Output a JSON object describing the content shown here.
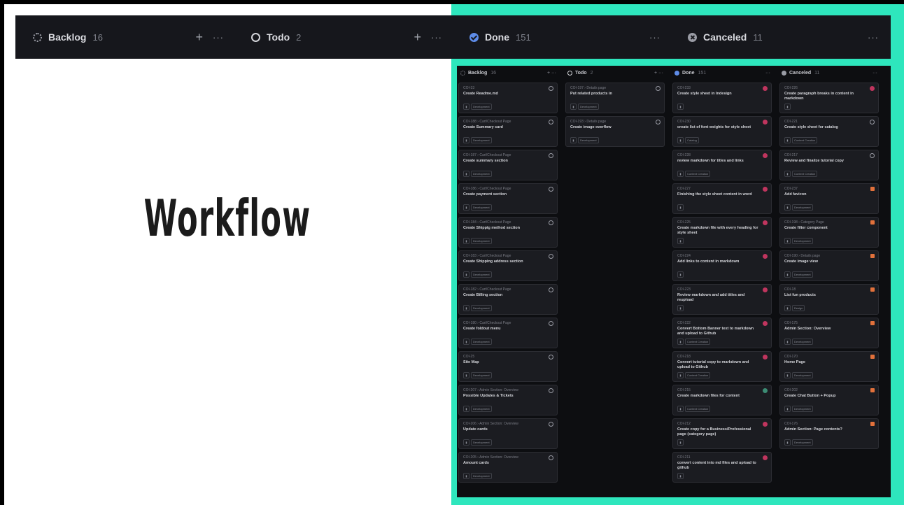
{
  "title": "Workflow",
  "header": {
    "columns": [
      {
        "icon": "backlog-status-icon",
        "name": "Backlog",
        "count": "16",
        "plus": "+",
        "more": "···"
      },
      {
        "icon": "todo-status-icon",
        "name": "Todo",
        "count": "2",
        "plus": "+",
        "more": "···"
      },
      {
        "icon": "done-status-icon",
        "name": "Done",
        "count": "151",
        "more": "···"
      },
      {
        "icon": "canceled-status-icon",
        "name": "Canceled",
        "count": "11",
        "more": "···"
      }
    ]
  },
  "board": {
    "columns": [
      {
        "name": "Backlog",
        "count": "16",
        "actions": "+ ···",
        "cards": [
          {
            "id": "COI-33",
            "title": "Create Readme.md",
            "tag": "Development"
          },
          {
            "id": "COI-188 › Cart/Checkout Page",
            "title": "Create Summary card",
            "tag": "Development"
          },
          {
            "id": "COI-187 › Cart/Checkout Page",
            "title": "Create summary section",
            "tag": "Development"
          },
          {
            "id": "COI-186 › Cart/Checkout Page",
            "title": "Create payment section",
            "tag": "Development"
          },
          {
            "id": "COI-184 › Cart/Checkout Page",
            "title": "Create Shippig method section",
            "tag": "Development"
          },
          {
            "id": "COI-183 › Cart/Checkout Page",
            "title": "Create Shipping address section",
            "tag": "Development"
          },
          {
            "id": "COI-182 › Cart/Checkout Page",
            "title": "Create Billing section",
            "tag": "Development"
          },
          {
            "id": "COI-180 › Cart/Checkout Page",
            "title": "Create foldout menu",
            "tag": "Development"
          },
          {
            "id": "COI-25",
            "title": "Site Map",
            "tag": "Development"
          },
          {
            "id": "COI-207 › Admin Section: Overview",
            "title": "Possible Updates & Tickets",
            "tag": "Development"
          },
          {
            "id": "COI-206 › Admin Section: Overview",
            "title": "Update cards",
            "tag": "Development"
          },
          {
            "id": "COI-205 › Admin Section: Overview",
            "title": "Amount cards",
            "tag": "Development"
          }
        ]
      },
      {
        "name": "Todo",
        "count": "2",
        "actions": "+ ···",
        "cards": [
          {
            "id": "COI-197 › Details page",
            "title": "Put related products in",
            "tag": "Development"
          },
          {
            "id": "COI-193 › Details page",
            "title": "Create image overflow",
            "tag": "Development"
          }
        ]
      },
      {
        "name": "Done",
        "count": "151",
        "actions": "···",
        "cards": [
          {
            "id": "COI-233",
            "title": "Create style sheet in Indesign",
            "tag": ""
          },
          {
            "id": "COI-230",
            "title": "create list of font weights for style sheet",
            "tag": "Catalog"
          },
          {
            "id": "COI-228",
            "title": "review markdown for titles and links",
            "tag": "Content Creation"
          },
          {
            "id": "COI-227",
            "title": "Finishing the style sheet content in word",
            "tag": ""
          },
          {
            "id": "COI-225",
            "title": "Create markdown file with every heading for style sheet",
            "tag": ""
          },
          {
            "id": "COI-224",
            "title": "Add links to content in markdown",
            "tag": ""
          },
          {
            "id": "COI-223",
            "title": "Review markdown and add titles and reupload",
            "tag": ""
          },
          {
            "id": "COI-222",
            "title": "Convert Bottom Banner text to markdown and upload to Github",
            "tag": "Content Creation"
          },
          {
            "id": "COI-218",
            "title": "Convert tutorial copy to markdown and upload to Github",
            "tag": "Content Creation"
          },
          {
            "id": "COI-215",
            "title": "Create markdown files for content",
            "tag": "Content Creation"
          },
          {
            "id": "COI-212",
            "title": "Create copy for a Business/Professional page (category page)",
            "tag": ""
          },
          {
            "id": "COI-211",
            "title": "convert content into md files and upload to github",
            "tag": ""
          }
        ]
      },
      {
        "name": "Canceled",
        "count": "11",
        "actions": "···",
        "cards": [
          {
            "id": "COI-226",
            "title": "Create paragraph breaks in content in markdown",
            "tag": ""
          },
          {
            "id": "COI-221",
            "title": "Create style sheet for catalog",
            "tag": "Content Creation"
          },
          {
            "id": "COI-217",
            "title": "Review and finalize tutorial copy",
            "tag": "Content Creation"
          },
          {
            "id": "COI-237",
            "title": "Add favicon",
            "tag": "Development"
          },
          {
            "id": "COI-198 › Category Page",
            "title": "Create filter component",
            "tag": "Development"
          },
          {
            "id": "COI-190 › Details page",
            "title": "Create image view",
            "tag": "Development"
          },
          {
            "id": "COI-18",
            "title": "List fun products",
            "tag": "Design"
          },
          {
            "id": "COI-175",
            "title": "Admin Section: Overview",
            "tag": "Development"
          },
          {
            "id": "COI-170",
            "title": "Home Page",
            "tag": "Development"
          },
          {
            "id": "COI-202",
            "title": "Create Chat Button + Popup",
            "tag": "Development"
          },
          {
            "id": "COI-176",
            "title": "Admin Section: Page contents?",
            "tag": "Development"
          }
        ]
      }
    ]
  }
}
